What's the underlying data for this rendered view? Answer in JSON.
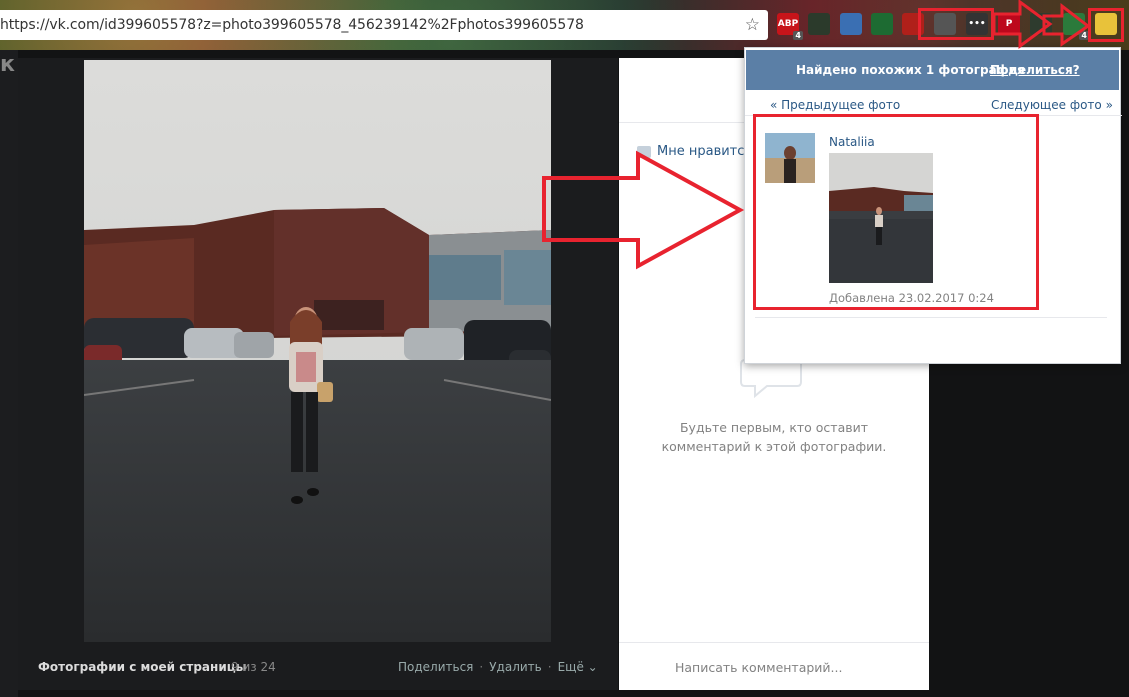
{
  "browser": {
    "url": "https://vk.com/id399605578?z=photo399605578_456239142%2Fphotos399605578",
    "extensions": [
      {
        "name": "adblock-plus-icon",
        "label": "ABP",
        "badge": "4",
        "color": "#c7141a"
      },
      {
        "name": "mail-extension-icon",
        "label": "",
        "badge": "",
        "color": "#2b3a2b"
      },
      {
        "name": "photo-extension-icon",
        "label": "",
        "badge": "",
        "color": "#3a6fb3"
      },
      {
        "name": "shield-extension-icon",
        "label": "",
        "badge": "",
        "color": "#1d6b32"
      },
      {
        "name": "share-extension-icon",
        "label": "",
        "badge": "",
        "color": "#b0201a"
      },
      {
        "name": "envelope-extension-icon",
        "label": "",
        "badge": "",
        "color": "#555555"
      },
      {
        "name": "more-extension-icon",
        "label": "•••",
        "badge": "",
        "color": "#333333"
      },
      {
        "name": "pinterest-icon",
        "label": "P",
        "badge": "",
        "color": "#bd081c"
      },
      {
        "name": "download-extension-icon",
        "label": "",
        "badge": "",
        "color": "#2e3b2e"
      },
      {
        "name": "tree-extension-icon",
        "label": "",
        "badge": "4",
        "color": "#2b7a3b"
      },
      {
        "name": "search-photo-extension-icon",
        "label": "",
        "badge": "",
        "color": "#e8c23a"
      }
    ]
  },
  "viewer": {
    "album_title": "Фотографии с моей страницы",
    "counter": "9 из 24",
    "share": "Поделиться",
    "delete": "Удалить",
    "more": "Ещё"
  },
  "side_panel": {
    "like": "Мне нравится",
    "empty_text_1": "Будьте первым, кто оставит",
    "empty_text_2": "комментарий к этой фотографии.",
    "comment_placeholder": "Написать комментарий..."
  },
  "popup": {
    "header": "Найдено похожих 1 фотография",
    "share_link": "Поделиться?",
    "prev": "« Предыдущее фото",
    "next": "Следующее фото »",
    "result": {
      "name": "Nataliia",
      "date": "Добавлена 23.02.2017 0:24"
    }
  },
  "colors": {
    "vk_blue": "#5b7fa6",
    "link": "#2a5885",
    "annotation_red": "#e8232f"
  }
}
